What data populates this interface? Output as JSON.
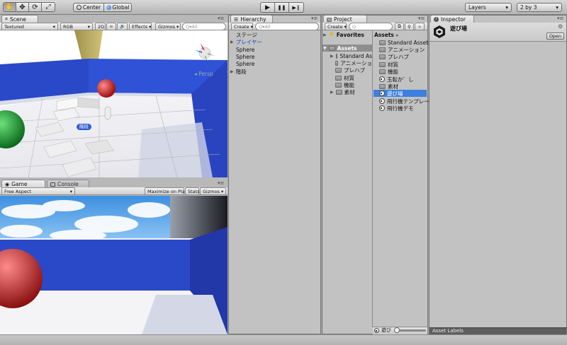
{
  "toolbar": {
    "tools": [
      {
        "name": "hand-tool-icon",
        "glyph": "✋"
      },
      {
        "name": "move-tool-icon",
        "glyph": "✥"
      },
      {
        "name": "rotate-tool-icon",
        "glyph": "⟳"
      },
      {
        "name": "scale-tool-icon",
        "glyph": "⤢"
      }
    ],
    "pivot_label": "Center",
    "space_label": "Global",
    "play_icon": "▶",
    "pause_icon": "❚❚",
    "step_icon": "▶❙",
    "layers_label": "Layers",
    "layout_label": "2 by 3",
    "dropdown_glyph": "▾"
  },
  "scene": {
    "tab_label": "Scene",
    "render_mode": "Textured",
    "color_mode": "RGB",
    "mode_2d": "2D",
    "light_glyph": "☼",
    "audio_glyph": "🔊",
    "effects": "Effects",
    "gizmos": "Gizmos",
    "search_placeholder": "Q▾All",
    "persp_label": "◂ Persp",
    "object_label": "階段",
    "menu_glyph": "▾≡"
  },
  "game": {
    "tab_label": "Game",
    "console_tab": "Console",
    "aspect": "Free Aspect",
    "maximize": "Maximize on Play",
    "stats": "Stats",
    "gizmos": "Gizmos",
    "menu_glyph": "▾≡"
  },
  "hierarchy": {
    "tab_label": "Hierarchy",
    "create": "Create",
    "search_placeholder": "Q▾All",
    "items": [
      "ステージ",
      "プレイヤー",
      "Sphere",
      "Sphere",
      "Sphere",
      "階段"
    ],
    "menu_glyph": "▾≡"
  },
  "project": {
    "tab_label": "Project",
    "create": "Create",
    "search_placeholder": "Q",
    "favorites": "Favorites",
    "assets_root": "Assets",
    "tree": [
      "Standard As",
      "アニメーショ",
      "プレハブ",
      "材質",
      "機能",
      "素材"
    ],
    "breadcrumb": "Assets",
    "breadcrumb_arrow": "▸",
    "files": [
      {
        "label": "Standard Assets",
        "type": "folder"
      },
      {
        "label": "アニメーション",
        "type": "folder"
      },
      {
        "label": "プレハブ",
        "type": "folder"
      },
      {
        "label": "材質",
        "type": "folder"
      },
      {
        "label": "機能",
        "type": "folder"
      },
      {
        "label": "玉転か゛し",
        "type": "scene"
      },
      {
        "label": "素材",
        "type": "folder"
      },
      {
        "label": "遊び場",
        "type": "scene"
      },
      {
        "label": "飛行機テンプレー",
        "type": "scene"
      },
      {
        "label": "飛行機デモ",
        "type": "scene"
      }
    ],
    "selected_file": "遊び場",
    "footer_path": "遊び",
    "menu_glyph": "▾≡"
  },
  "inspector": {
    "tab_label": "Inspector",
    "asset_name": "遊び場",
    "open_button": "Open",
    "gear_glyph": "⚙",
    "asset_labels": "Asset Labels",
    "menu_glyph": "▾≡"
  },
  "colors": {
    "selection": "#3d80df",
    "wall_blue": "#2a49c8",
    "link_blue": "#1a3ec4"
  }
}
